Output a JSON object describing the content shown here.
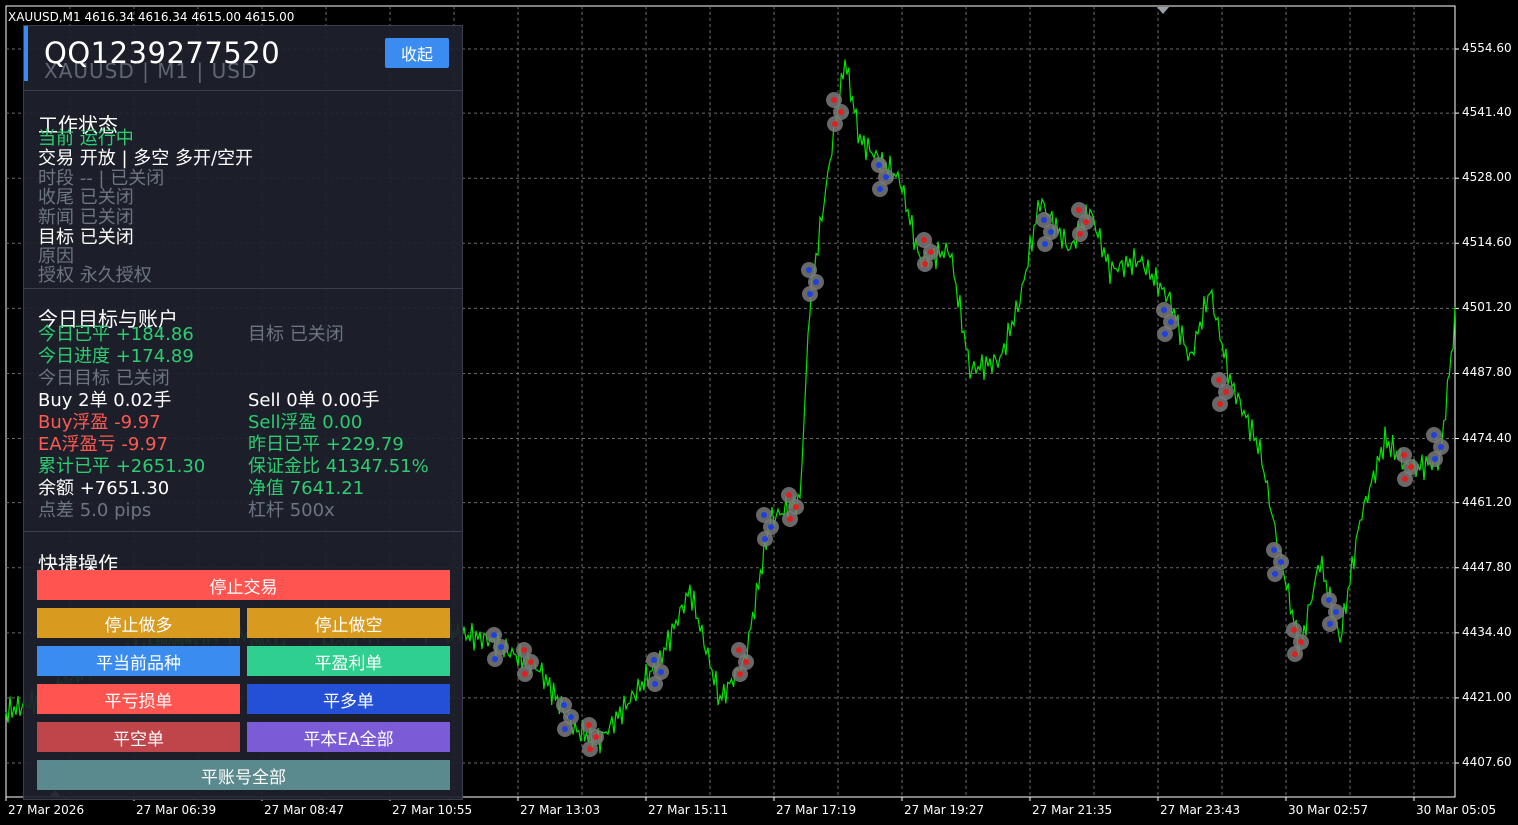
{
  "chart": {
    "title": "XAUUSD,M1  4616.34 4616.34 4615.00 4615.00",
    "y_ticks": [
      "4554.60",
      "4541.40",
      "4528.00",
      "4514.60",
      "4501.20",
      "4487.80",
      "4474.40",
      "4461.20",
      "4447.80",
      "4434.40",
      "4421.00",
      "4407.60"
    ],
    "x_ticks": [
      "27 Mar 2026",
      "27 Mar 06:39",
      "27 Mar 08:47",
      "27 Mar 10:55",
      "27 Mar 13:03",
      "27 Mar 15:11",
      "27 Mar 17:19",
      "27 Mar 19:27",
      "27 Mar 21:35",
      "27 Mar 23:43",
      "30 Mar 02:57",
      "30 Mar 05:05"
    ],
    "line_color": "#00e600",
    "grid_color": "#6b6b6b"
  },
  "panel": {
    "account_id": "QQ1239277520",
    "account_sub": "XAUUSD | M1 | USD",
    "collapse_label": "收起",
    "status": {
      "title": "工作状态",
      "current": "当前  运行中",
      "trade": "交易  开放 | 多空  多开/空开",
      "period": "时段  --  | 已关闭",
      "ending": "收尾  已关闭",
      "news": "新闻  已关闭",
      "target": "目标  已关闭",
      "reason": "原因",
      "license": "授权  永久授权"
    },
    "account": {
      "title": "今日目标与账户",
      "today_closed": "今日已平  +184.86",
      "target_status": "目标  已关闭",
      "today_progress": "今日进度  +174.89",
      "today_target": "今日目标  已关闭",
      "buy": "Buy  2单  0.02手",
      "sell": "Sell  0单  0.00手",
      "buy_float": "Buy浮盈  -9.97",
      "sell_float": "Sell浮盈  0.00",
      "ea_float": "EA浮盈亏  -9.97",
      "yesterday_closed": "昨日已平  +229.79",
      "total_closed": "累计已平  +2651.30",
      "margin_ratio": "保证金比  41347.51%",
      "balance": "余额  +7651.30",
      "equity": "净值  7641.21",
      "spread": "点差  5.0 pips",
      "leverage": "杠杆  500x"
    },
    "quick": {
      "title": "快捷操作",
      "stop_trading": "停止交易",
      "stop_long": "停止做多",
      "stop_short": "停止做空",
      "close_current": "平当前品种",
      "close_profit": "平盈利单",
      "close_loss": "平亏损单",
      "close_long": "平多单",
      "close_short": "平空单",
      "close_ea_all": "平本EA全部",
      "close_account_all": "平账号全部"
    },
    "colors": {
      "accent": "#3b8cf0",
      "red_btn": "#ff5450",
      "orange_btn": "#d89a1f",
      "blue_btn": "#3b8cf0",
      "teal_btn": "#2fcf90",
      "navy_btn": "#2450d8",
      "darkred_btn": "#c0454a",
      "purple_btn": "#7b5bd6",
      "slate_btn": "#5a8a8d"
    }
  }
}
